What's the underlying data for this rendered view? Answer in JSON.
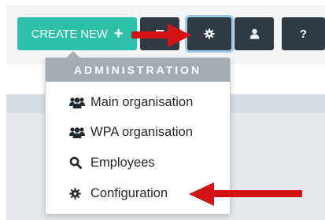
{
  "toolbar": {
    "create_label": "CREATE NEW",
    "create_plus": "+",
    "help_label": "?"
  },
  "admin_menu": {
    "header": "ADMINISTRATION",
    "items": [
      {
        "label": "Main organisation",
        "icon": "users-icon"
      },
      {
        "label": "WPA organisation",
        "icon": "users-icon"
      },
      {
        "label": "Employees",
        "icon": "search-icon"
      },
      {
        "label": "Configuration",
        "icon": "gear-icon"
      }
    ]
  },
  "colors": {
    "create_button": "#2cc0a8",
    "dark_button": "#2f3a43",
    "menu_header": "#a3acb3",
    "annotation_arrow": "#d41414"
  }
}
